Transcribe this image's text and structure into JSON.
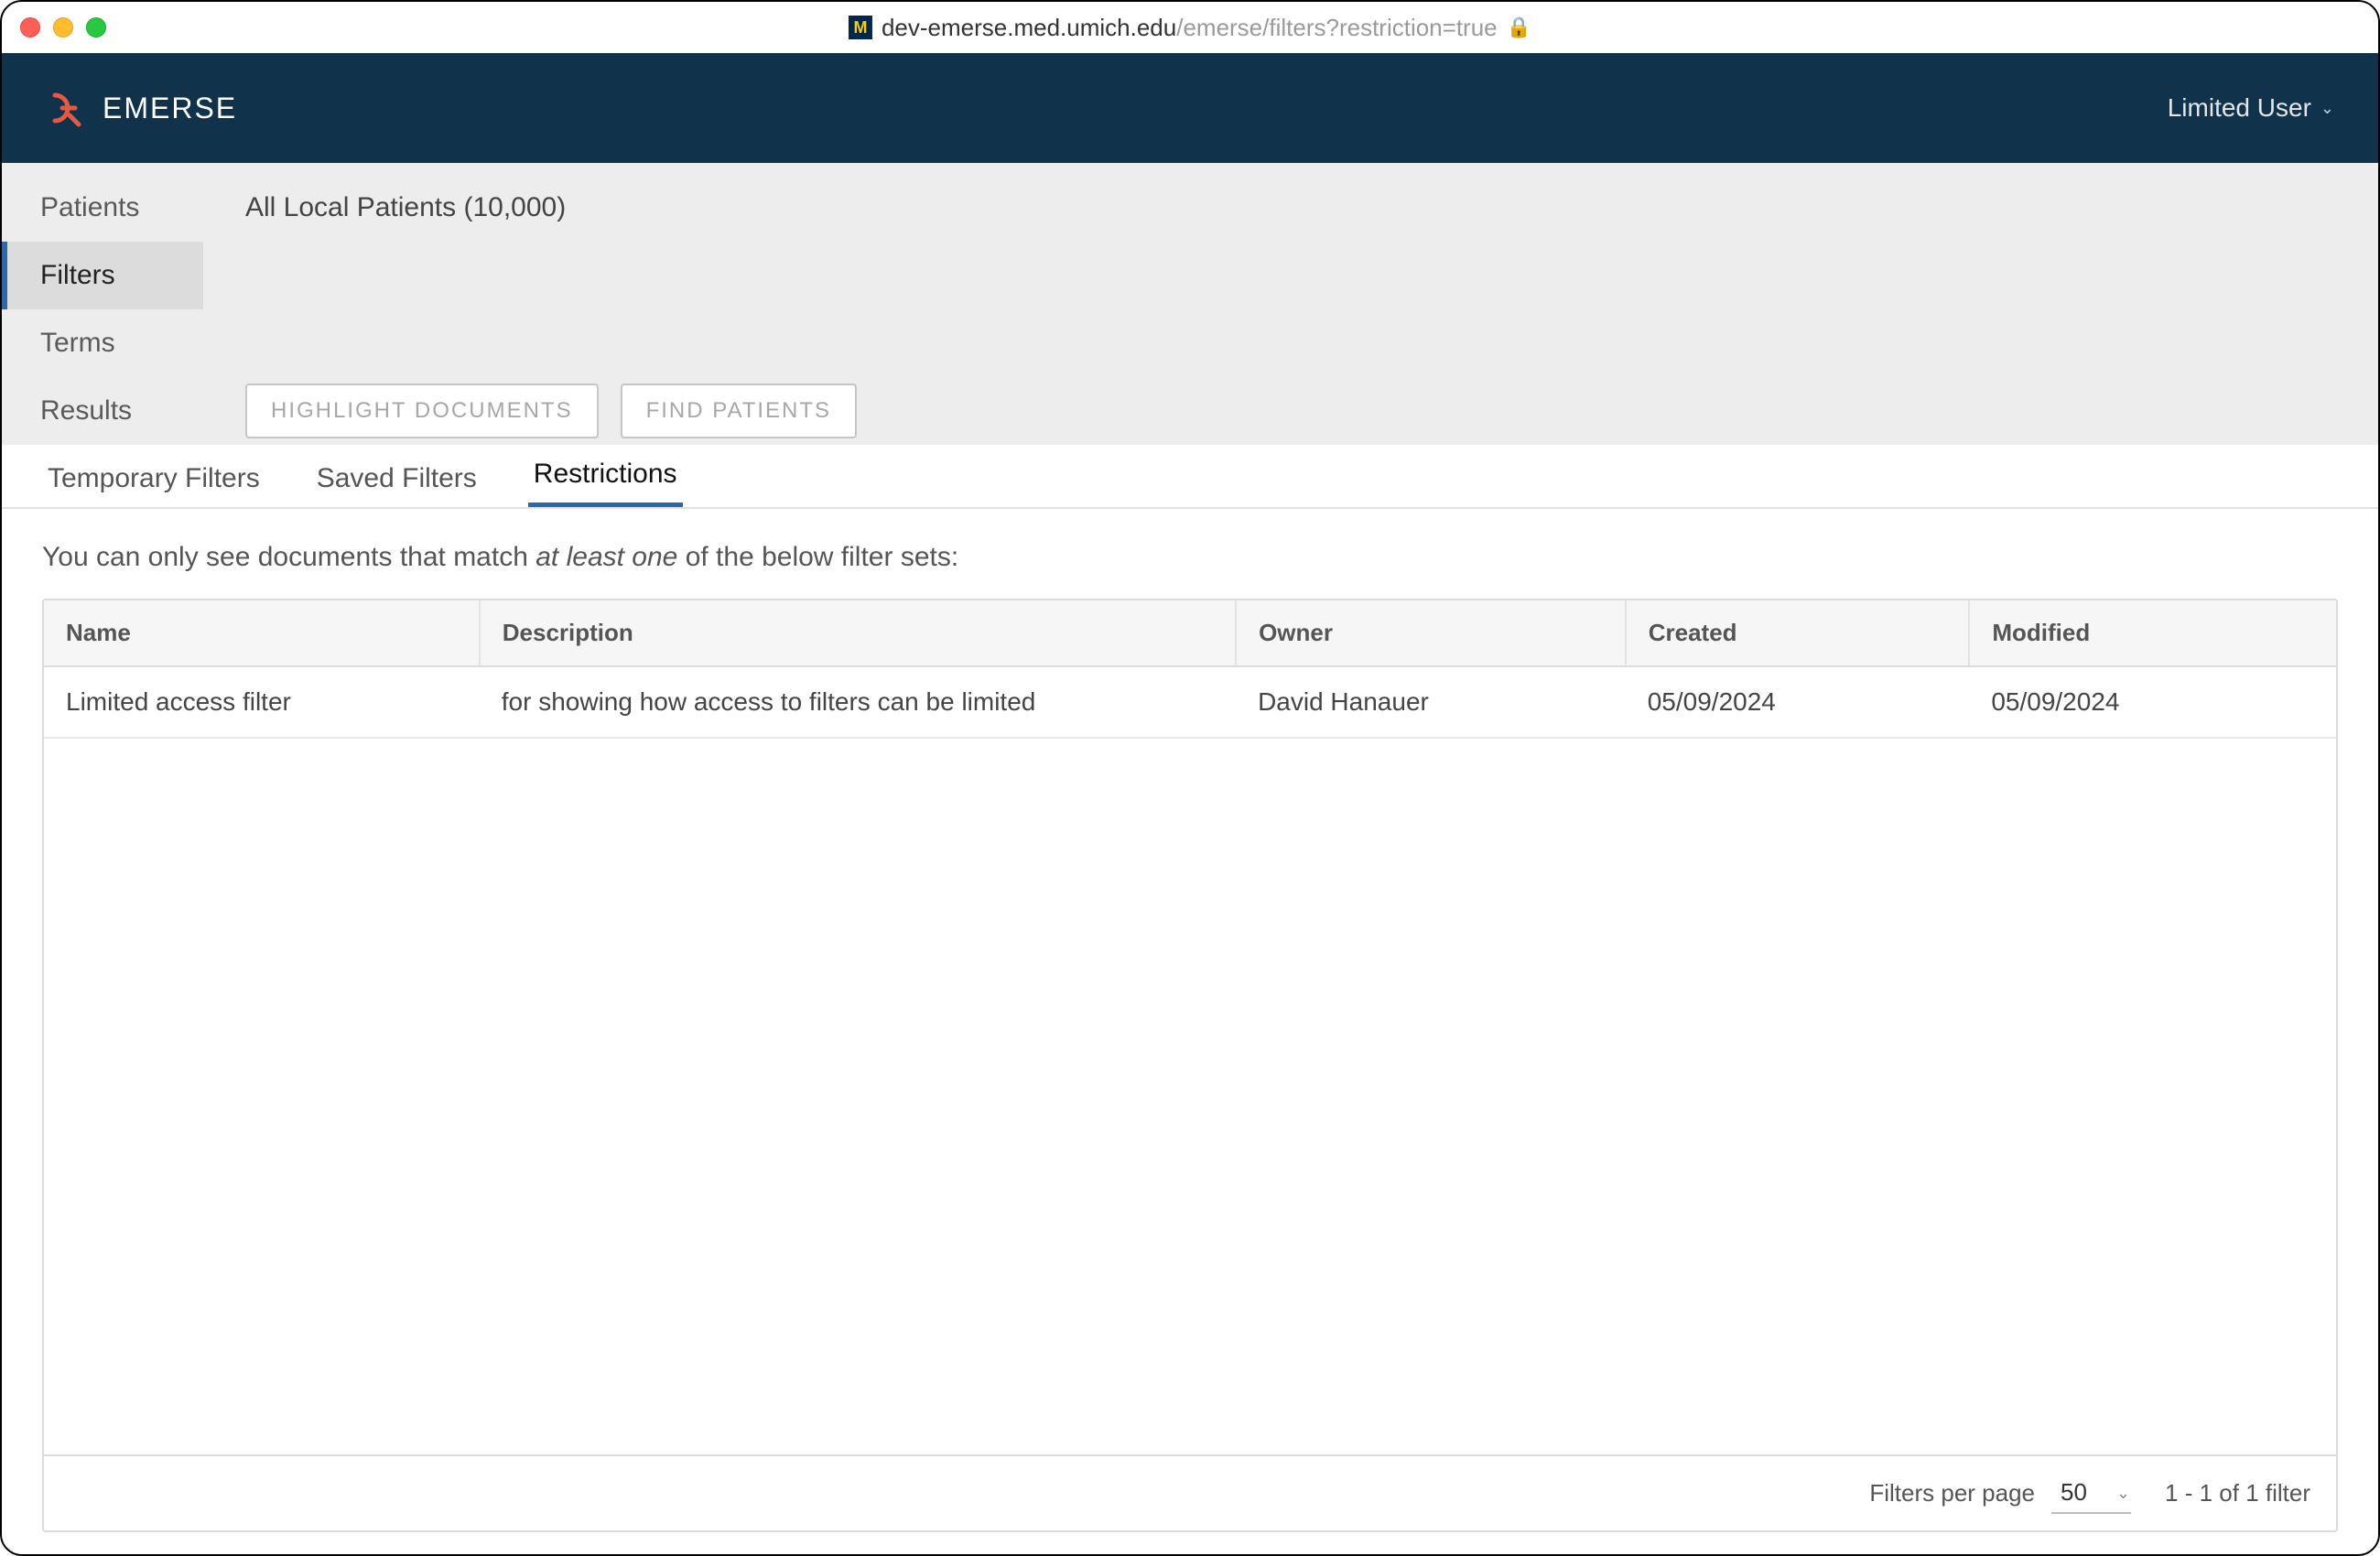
{
  "titlebar": {
    "favicon_letter": "M",
    "url_host": "dev-emerse.med.umich.edu",
    "url_path": "/emerse/filters?restriction=true"
  },
  "header": {
    "brand": "EMERSE",
    "user_label": "Limited User"
  },
  "sidebar": {
    "items": [
      {
        "label": "Patients"
      },
      {
        "label": "Filters"
      },
      {
        "label": "Terms"
      },
      {
        "label": "Results"
      }
    ]
  },
  "sub": {
    "patients_summary": "All Local Patients (10,000)",
    "highlight_btn": "HIGHLIGHT DOCUMENTS",
    "find_btn": "FIND PATIENTS"
  },
  "tabs": [
    {
      "label": "Temporary Filters"
    },
    {
      "label": "Saved Filters"
    },
    {
      "label": "Restrictions"
    }
  ],
  "intro": {
    "prefix": "You can only see documents that match ",
    "emph": "at least one",
    "suffix": " of the below filter sets:"
  },
  "table": {
    "headers": {
      "name": "Name",
      "description": "Description",
      "owner": "Owner",
      "created": "Created",
      "modified": "Modified"
    },
    "rows": [
      {
        "name": "Limited access filter",
        "description": "for showing how access to filters can be limited",
        "owner": "David Hanauer",
        "created": "05/09/2024",
        "modified": "05/09/2024"
      }
    ],
    "footer": {
      "per_page_label": "Filters per page",
      "per_page_value": "50",
      "range_text": "1  -  1  of  1 filter"
    }
  }
}
